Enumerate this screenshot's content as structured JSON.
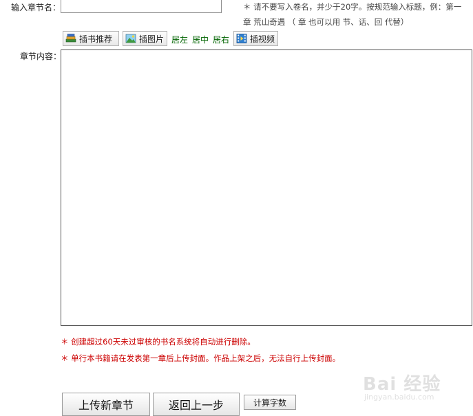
{
  "form": {
    "title_label": "输入章节名：",
    "title_value": "",
    "title_hint_line1": "＊ 请不要写入卷名，并少于20字。按规范输入标题，例：第一",
    "title_hint_line2": "章 荒山奇遇 （ 章 也可以用 节、话、回 代替）",
    "content_label": "章节内容：",
    "content_value": ""
  },
  "toolbar": {
    "insert_book_label": "插书推荐",
    "insert_image_label": "插图片",
    "align_left_label": "居左",
    "align_center_label": "居中",
    "align_right_label": "居右",
    "insert_video_label": "插视频",
    "icons": {
      "insert_book": "books-icon",
      "insert_image": "image-icon",
      "insert_video": "film-icon"
    }
  },
  "notices": {
    "auto_delete": "＊ 创建超过60天未过审核的书名系统将自动进行删除。",
    "cover_rule": "＊ 单行本书籍请在发表第一章后上传封面。作品上架之后，无法自行上传封面。"
  },
  "actions": {
    "upload_label": "上传新章节",
    "back_label": "返回上一步",
    "count_label": "计算字数"
  },
  "watermark": {
    "main": "Bai 经验",
    "sub": "jingyan.baidu.com"
  },
  "colors": {
    "notice": "#cc0000",
    "align_link": "#006400"
  }
}
